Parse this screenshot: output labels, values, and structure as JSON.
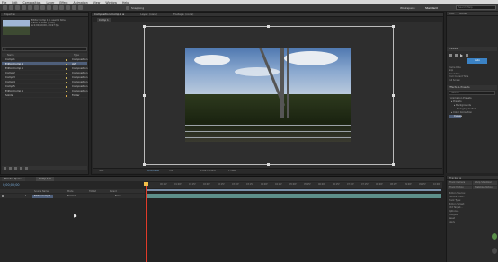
{
  "menu": [
    "File",
    "Edit",
    "Composition",
    "Layer",
    "Effect",
    "Animation",
    "View",
    "Window",
    "Help"
  ],
  "toolbar": {
    "snapping": "Snapping",
    "workspace_label": "Workspace:",
    "workspace_value": "Standard",
    "search_placeholder": "Search Help"
  },
  "project": {
    "tab": "Project ≡",
    "info_lines": [
      "Editor Comp 1 ▾, used 1 time",
      "1920 × 1080 (1.00)",
      "Δ 0;00;10;00, 29.97 fps"
    ],
    "col_name": "Name",
    "col_type": "Type",
    "items": [
      {
        "name": "Comp 1",
        "type": "Composition",
        "color": "#c8b15a",
        "selected": false
      },
      {
        "name": "Editor Comp 1",
        "type": "AVI",
        "color": "#c8b15a",
        "selected": true
      },
      {
        "name": "Editor Comp 1",
        "type": "Composition",
        "color": "#c8b15a",
        "selected": false
      },
      {
        "name": "Comp 2",
        "type": "Composition",
        "color": "#c8b15a",
        "selected": false
      },
      {
        "name": "Comp 3",
        "type": "Composition",
        "color": "#c8b15a",
        "selected": false
      },
      {
        "name": "Comp 4",
        "type": "Composition",
        "color": "#c8b15a",
        "selected": false
      },
      {
        "name": "Comp 5",
        "type": "Composition",
        "color": "#c8b15a",
        "selected": false
      },
      {
        "name": "Editor Comp 1",
        "type": "Composition",
        "color": "#c8b15a",
        "selected": false
      },
      {
        "name": "Solids",
        "type": "Folder",
        "color": "#d9a84a",
        "selected": false
      }
    ]
  },
  "composition": {
    "tab": "Composition: Comp 1 ≡",
    "tab2": "Layer: (none)",
    "tab3": "Footage: (none)",
    "breadcrumb": "Comp 1",
    "zoom": "50%",
    "timecode": "0;00;00;00",
    "resolution": "Full",
    "camera": "Active Camera",
    "views": "1 View"
  },
  "right_panel": {
    "info_tab": "Info",
    "audio_tab": "Audio",
    "preview_tab": "Preview",
    "effects_tab": "Effects & Presets",
    "effects_search": "Search",
    "fx_items": [
      "* Animation Presets",
      "▸ Presets",
      "▸ Backgrounds",
      "Swinging Curtain",
      "▸ Color Correction",
      "Curves"
    ],
    "preview_labels": [
      "Frame Rate",
      "Skip",
      "Resolution",
      "From Current Time",
      "Full Screen"
    ],
    "preview_value": "Auto"
  },
  "timeline": {
    "tab_render": "Render Queue",
    "tab_comp": "Comp 1 ≡",
    "timecode": "0;00;00;00",
    "col_source": "Source Name",
    "col_mode": "Mode",
    "col_trkmat": "TrkMat",
    "col_parent": "Parent",
    "layer": {
      "index": "1",
      "name": "Editor Comp 1",
      "mode": "Normal",
      "parent": "None"
    },
    "ruler_ticks": [
      "00f",
      "00:15f",
      "01:00f",
      "01:15f",
      "02:00f",
      "02:15f",
      "03:00f",
      "03:15f",
      "04:00f",
      "04:15f",
      "05:00f",
      "05:15f",
      "06:00f",
      "06:15f",
      "07:00f",
      "07:15f",
      "08:00f",
      "08:15f",
      "09:00f",
      "09:15f",
      "10:00f"
    ]
  },
  "right_panel2": {
    "tab": "Tracker ≡",
    "buttons": [
      "Track Camera",
      "Warp Stabilizer",
      "Track Motion",
      "Stabilize Motion"
    ],
    "rows": [
      "Motion Source:",
      "Current Track:",
      "Track Type:",
      "Motion Target:",
      "Edit Target...",
      "Options...",
      "Analyze:",
      "Reset",
      "Apply"
    ]
  }
}
